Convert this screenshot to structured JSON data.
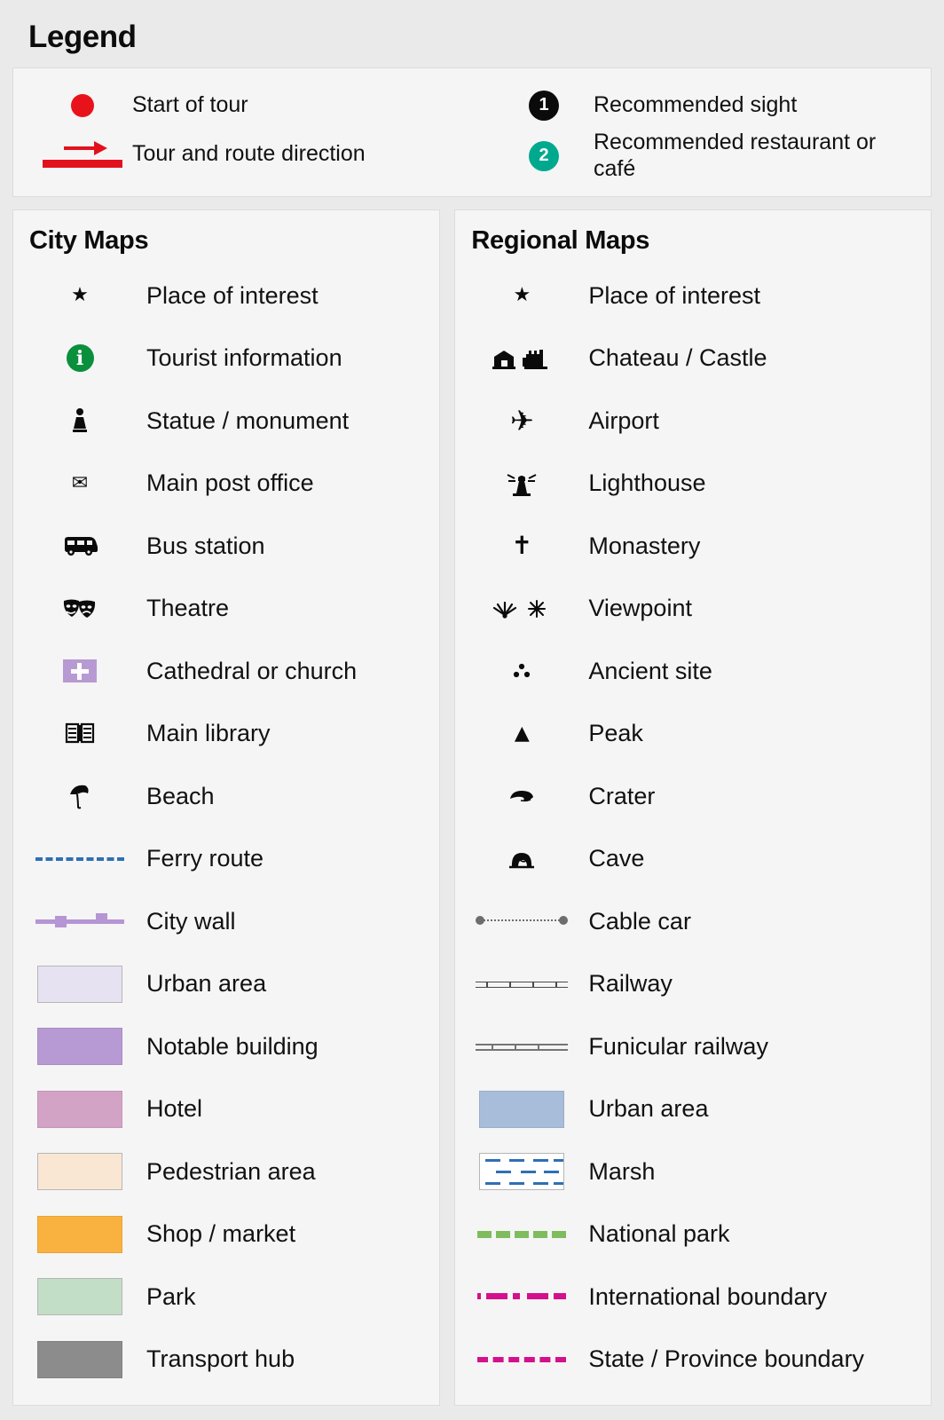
{
  "page": {
    "title": "Legend",
    "background": "#eaeaea",
    "panel_background": "#f5f5f5"
  },
  "tour": {
    "left": [
      {
        "icon": "red-dot-icon",
        "label": "Start of tour"
      },
      {
        "icon": "arrow-route-icon",
        "label": "Tour and route direction"
      }
    ],
    "right": [
      {
        "icon": "numbered-badge-black-icon",
        "badge": "1",
        "label": "Recommended sight",
        "color": "#0b0b0b"
      },
      {
        "icon": "numbered-badge-teal-icon",
        "badge": "2",
        "label": "Recommended restaurant or café",
        "color": "#00a98e"
      }
    ]
  },
  "city_maps": {
    "title": "City Maps",
    "items": [
      {
        "icon": "star-icon",
        "label": "Place of interest"
      },
      {
        "icon": "information-icon",
        "label": "Tourist information",
        "color": "#0a8f3c"
      },
      {
        "icon": "statue-icon",
        "label": "Statue / monument"
      },
      {
        "icon": "envelope-icon",
        "label": "Main post office"
      },
      {
        "icon": "bus-icon",
        "label": "Bus station"
      },
      {
        "icon": "theatre-masks-icon",
        "label": "Theatre"
      },
      {
        "icon": "church-cross-icon",
        "label": "Cathedral or church",
        "color": "#b89ad2"
      },
      {
        "icon": "open-book-icon",
        "label": "Main library"
      },
      {
        "icon": "beach-umbrella-icon",
        "label": "Beach"
      },
      {
        "icon": "dashed-line-icon",
        "label": "Ferry route",
        "color": "#2f6fb5"
      },
      {
        "icon": "city-wall-icon",
        "label": "City wall",
        "color": "#b595d4"
      },
      {
        "icon": "color-swatch-icon",
        "label": "Urban area",
        "color": "#e6e2f2"
      },
      {
        "icon": "color-swatch-icon",
        "label": "Notable building",
        "color": "#b79ad4"
      },
      {
        "icon": "color-swatch-icon",
        "label": "Hotel",
        "color": "#d3a3c6"
      },
      {
        "icon": "color-swatch-icon",
        "label": "Pedestrian area",
        "color": "#f9e6d3"
      },
      {
        "icon": "color-swatch-icon",
        "label": "Shop / market",
        "color": "#f9b23f"
      },
      {
        "icon": "color-swatch-icon",
        "label": "Park",
        "color": "#c3dec6"
      },
      {
        "icon": "color-swatch-icon",
        "label": "Transport hub",
        "color": "#8c8c8c"
      }
    ]
  },
  "regional_maps": {
    "title": "Regional Maps",
    "items": [
      {
        "icon": "star-icon",
        "label": "Place of interest"
      },
      {
        "icon": "chateau-castle-icon",
        "label": "Chateau / Castle"
      },
      {
        "icon": "airplane-icon",
        "label": "Airport"
      },
      {
        "icon": "lighthouse-icon",
        "label": "Lighthouse"
      },
      {
        "icon": "cross-icon",
        "label": "Monastery"
      },
      {
        "icon": "viewpoint-icon",
        "label": "Viewpoint"
      },
      {
        "icon": "ancient-site-icon",
        "label": "Ancient site"
      },
      {
        "icon": "triangle-peak-icon",
        "label": "Peak"
      },
      {
        "icon": "crater-icon",
        "label": "Crater"
      },
      {
        "icon": "cave-icon",
        "label": "Cave"
      },
      {
        "icon": "cable-car-icon",
        "label": "Cable car",
        "color": "#6d6d6d"
      },
      {
        "icon": "railway-icon",
        "label": "Railway",
        "color": "#4a4a4a"
      },
      {
        "icon": "funicular-railway-icon",
        "label": "Funicular railway",
        "color": "#6f6f6f"
      },
      {
        "icon": "color-swatch-icon",
        "label": "Urban area",
        "color": "#a7bdda"
      },
      {
        "icon": "marsh-pattern-icon",
        "label": "Marsh",
        "color": "#2f6fb5"
      },
      {
        "icon": "dashed-line-icon",
        "label": "National park",
        "color": "#7fbc5e"
      },
      {
        "icon": "dash-dot-line-icon",
        "label": "International boundary",
        "color": "#d4118c"
      },
      {
        "icon": "dashed-line-icon",
        "label": "State / Province boundary",
        "color": "#d4118c"
      }
    ]
  }
}
